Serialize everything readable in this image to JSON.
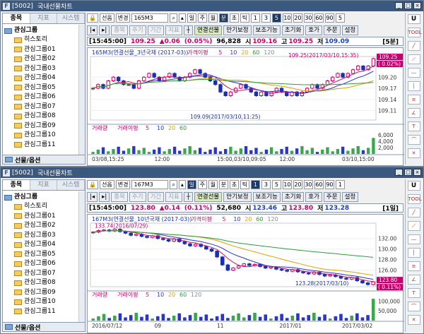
{
  "window1": {
    "code": "[5002]",
    "title": "국내선물차트",
    "tabs": [
      "종목",
      "지표",
      "시스템"
    ],
    "tree_root": "관심그룹",
    "tree_items": [
      "히스토리",
      "관심그룹01",
      "관심그룹02",
      "관심그룹03",
      "관심그룹04",
      "관심그룹05",
      "관심그룹06",
      "관심그룹07",
      "관심그룹08",
      "관심그룹09",
      "관심그룹10",
      "관심그룹11"
    ],
    "tree_bottom": "선물/옵션",
    "toolbar": {
      "type": "선옵",
      "change": "변경",
      "symbol": "165M3",
      "periods": [
        "일",
        "주",
        "월",
        "분",
        "초",
        "틱"
      ],
      "numbers": [
        "1",
        "3",
        "5",
        "10",
        "20",
        "30",
        "60",
        "90",
        "5"
      ],
      "active_period": "분",
      "active_number": "5"
    },
    "toolbar2": {
      "dim": [
        "종목",
        "주기",
        "기간",
        "지표"
      ],
      "buttons": [
        "연결선물",
        "만기보정",
        "보조기능",
        "초기화",
        "호가",
        "주문",
        "설정"
      ]
    },
    "info": {
      "time": "[15:45:00]",
      "price": "109.25",
      "change": "▲0.06",
      "pct": "(0.05%)",
      "volume": "96,828",
      "open_label": "시",
      "open": "109.16",
      "high_label": "고",
      "high": "109.25",
      "low_label": "저",
      "low": "109.09",
      "period": "[5분]"
    },
    "chart_title": "165M3(연결선물_3년국채 (2017-03))",
    "chart_legend_ma": "가격이평",
    "ma_values": [
      "5",
      "10",
      "20",
      "60",
      "120"
    ],
    "annotation_high": "109.25(2017/03/10,15:35)",
    "annotation_low": "109.09(2017/03/10,11:25)",
    "yticks": [
      "109.20",
      "109.17",
      "109.14",
      "109.11"
    ],
    "price_tag": "109.25",
    "pct_tag": "( 0.02%)",
    "vol_title": "거래량",
    "vol_ma_title": "거래이평",
    "vol_ma": [
      "5",
      "10",
      "20",
      "60"
    ],
    "vol_yticks": [
      "6,000",
      "4,000",
      "2,000"
    ],
    "xticks": [
      "03/08,15:25",
      "12:00",
      "15:00,03/10,09:05",
      "12:00",
      "03/10,15:00"
    ]
  },
  "window2": {
    "code": "[5002]",
    "title": "국내선물차트",
    "tabs": [
      "종목",
      "지표",
      "시스템"
    ],
    "tree_root": "관심그룹",
    "tree_items": [
      "히스토리",
      "관심그룹01",
      "관심그룹02",
      "관심그룹03",
      "관심그룹04",
      "관심그룹05",
      "관심그룹06",
      "관심그룹07",
      "관심그룹08",
      "관심그룹09",
      "관심그룹10",
      "관심그룹11"
    ],
    "tree_bottom": "선물/옵션",
    "toolbar": {
      "type": "선옵",
      "change": "변경",
      "symbol": "167M3",
      "periods": [
        "일",
        "주",
        "월",
        "분",
        "초",
        "틱"
      ],
      "numbers": [
        "1",
        "3",
        "5",
        "10",
        "20",
        "30",
        "60",
        "90",
        "1"
      ],
      "active_period": "일",
      "active_number": "1"
    },
    "toolbar2": {
      "dim": [
        "종목",
        "주기",
        "기간",
        "지표"
      ],
      "buttons": [
        "연결선물",
        "만기보정",
        "보조기능",
        "초기화",
        "호가",
        "주문",
        "설정"
      ]
    },
    "info": {
      "time": "[15:45:00]",
      "price": "123.80",
      "change": "▲0.14",
      "pct": "(0.11%)",
      "volume": "52,680",
      "open_label": "시",
      "open": "123.46",
      "high_label": "고",
      "high": "123.80",
      "low_label": "저",
      "low": "123.28",
      "period": "[1일]"
    },
    "chart_title": "167M3(연결선물_10년국채 (2017-03))",
    "chart_legend_ma": "가격이평",
    "ma_values": [
      "5",
      "10",
      "20",
      "60",
      "120"
    ],
    "annotation_high": "133.74(2016/07/29)",
    "annotation_low": "123.28(2017/03/10)",
    "yticks": [
      "132.00",
      "130.00",
      "128.00",
      "126.00"
    ],
    "price_tag": "123.80",
    "pct_tag": "( 0.11%)",
    "vol_title": "거래량",
    "vol_ma_title": "거래이평",
    "vol_ma": [
      "5",
      "10",
      "20",
      "60",
      "120"
    ],
    "vol_yticks": [
      "100,000",
      "50,000"
    ],
    "xticks": [
      "2016/07/12",
      "09",
      "11",
      "2017/01",
      "2017/03/02"
    ]
  },
  "colors": {
    "ma5": "#d01070",
    "ma10": "#2a36c8",
    "ma20": "#e0a000",
    "ma60": "#2e9c3a",
    "ma120": "#8a8a8a",
    "up": "#d0006a",
    "down": "#1a2fb0"
  },
  "chart_data": [
    {
      "type": "candlestick",
      "title": "165M3(연결선물_3년국채 (2017-03))",
      "interval": "5분",
      "ylim": [
        109.09,
        109.25
      ],
      "x_labels": [
        "03/08,15:25",
        "12:00",
        "15:00,03/10,09:05",
        "12:00",
        "03/10,15:00"
      ],
      "close": [
        109.17,
        109.18,
        109.17,
        109.19,
        109.2,
        109.19,
        109.18,
        109.18,
        109.17,
        109.19,
        109.2,
        109.21,
        109.2,
        109.19,
        109.2,
        109.21,
        109.2,
        109.19,
        109.2,
        109.21,
        109.22,
        109.21,
        109.2,
        109.19,
        109.18,
        109.16,
        109.15,
        109.16,
        109.17,
        109.18,
        109.17,
        109.16,
        109.15,
        109.16,
        109.15,
        109.16,
        109.17,
        109.16,
        109.15,
        109.16,
        109.15,
        109.16,
        109.17,
        109.18,
        109.17,
        109.18,
        109.19,
        109.2,
        109.21,
        109.2,
        109.21,
        109.22,
        109.23,
        109.22,
        109.23,
        109.25
      ],
      "high": 109.25,
      "low": 109.09,
      "volume_ylim": [
        0,
        8000
      ]
    },
    {
      "type": "candlestick",
      "title": "167M3(연결선물_10년국채 (2017-03))",
      "interval": "1일",
      "ylim": [
        123.28,
        134.5
      ],
      "x_labels": [
        "2016/07/12",
        "09",
        "11",
        "2017/01",
        "2017/03/02"
      ],
      "close": [
        133.2,
        133.5,
        133.6,
        133.4,
        133.74,
        133.3,
        133.0,
        132.6,
        132.8,
        132.4,
        132.2,
        132.5,
        132.0,
        131.8,
        131.5,
        131.9,
        131.4,
        131.0,
        130.6,
        130.9,
        130.5,
        130.0,
        129.6,
        128.5,
        127.0,
        126.0,
        126.4,
        126.8,
        127.2,
        126.9,
        127.1,
        126.7,
        126.4,
        126.6,
        126.2,
        126.0,
        125.8,
        126.1,
        125.7,
        125.5,
        125.3,
        125.6,
        125.2,
        124.9,
        125.1,
        124.8,
        124.5,
        124.3,
        124.6,
        124.0,
        123.6,
        123.28,
        123.8
      ],
      "high": 133.74,
      "low": 123.28,
      "volume_ylim": [
        0,
        130000
      ]
    }
  ]
}
